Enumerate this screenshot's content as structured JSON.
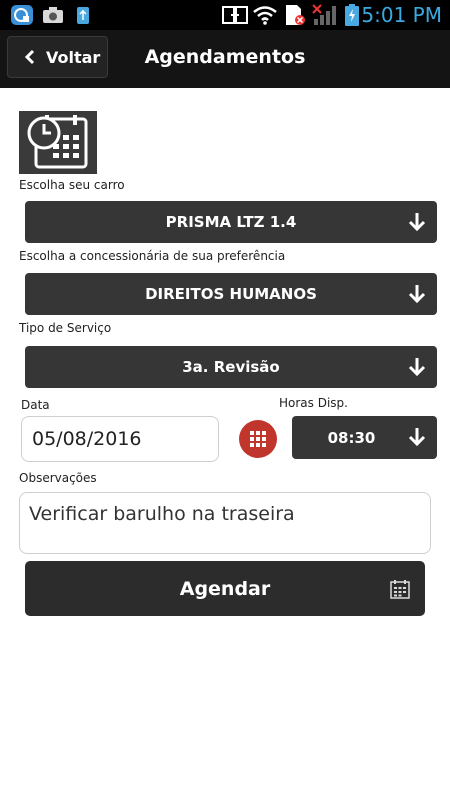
{
  "status_bar": {
    "time": "5:01 PM",
    "icons": [
      "app-notification-icon",
      "camera-icon",
      "usb-icon",
      "screen-mirror-icon",
      "wifi-icon",
      "sim-alert-icon",
      "signal-icon",
      "battery-charging-icon"
    ],
    "time_color": "#39a9e0"
  },
  "header": {
    "back_label": "Voltar",
    "title": "Agendamentos"
  },
  "form": {
    "car_label": "Escolha seu carro",
    "car_value": "PRISMA LTZ 1.4",
    "dealer_label": "Escolha a concessionária de sua preferência",
    "dealer_value": "DIREITOS HUMANOS",
    "service_label": "Tipo de Serviço",
    "service_value": "3a. Revisão",
    "date_label": "Data",
    "date_value": "05/08/2016",
    "hours_label": "Horas Disp.",
    "hours_value": "08:30",
    "notes_label": "Observações",
    "notes_value": "Verificar barulho na traseira",
    "submit_label": "Agendar"
  },
  "colors": {
    "header_bg": "#141414",
    "select_bg": "#363636",
    "accent_red": "#c0362c"
  }
}
